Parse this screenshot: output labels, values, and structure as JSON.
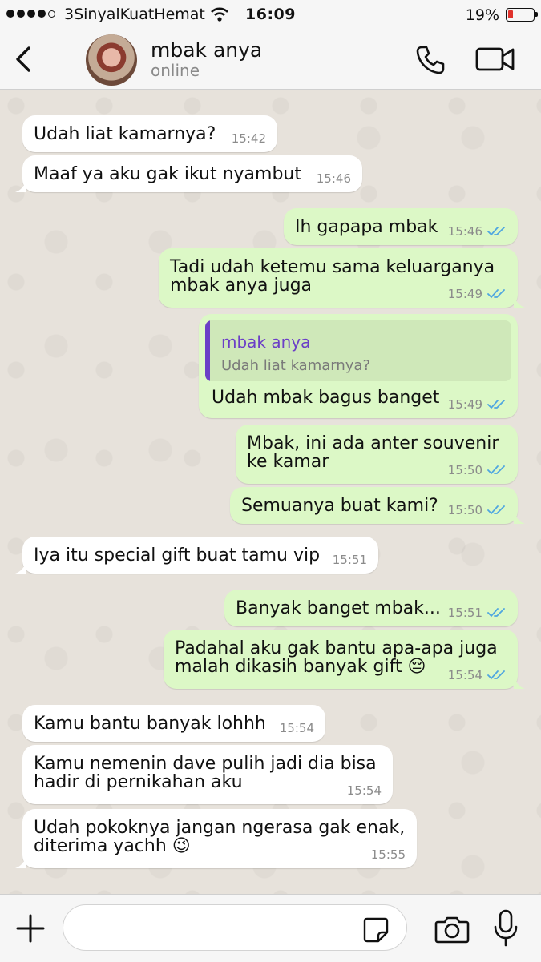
{
  "status_bar": {
    "carrier": "3SinyalKuatHemat",
    "time": "16:09",
    "battery": "19%"
  },
  "header": {
    "contact_name": "mbak anya",
    "contact_status": "online",
    "icons": [
      "back-icon",
      "avatar",
      "phone-icon",
      "video-icon"
    ]
  },
  "messages": [
    {
      "dir": "in",
      "text": "Udah liat kamarnya?",
      "time": "15:42"
    },
    {
      "dir": "in",
      "text": "Maaf ya aku gak ikut nyambut",
      "time": "15:46"
    },
    {
      "dir": "out",
      "text": "Ih gapapa mbak",
      "time": "15:46"
    },
    {
      "dir": "out",
      "line1": "Tadi udah ketemu sama keluarganya",
      "line2": "mbak anya juga",
      "time": "15:49"
    },
    {
      "dir": "out",
      "quote_name": "mbak anya",
      "quote_text": "Udah liat kamarnya?",
      "text": "Udah mbak bagus banget",
      "time": "15:49"
    },
    {
      "dir": "out",
      "line1": "Mbak, ini ada anter souvenir",
      "line2": "ke kamar",
      "time": "15:50"
    },
    {
      "dir": "out",
      "text": "Semuanya buat kami?",
      "time": "15:50"
    },
    {
      "dir": "in",
      "text": "Iya itu special gift buat tamu vip",
      "time": "15:51"
    },
    {
      "dir": "out",
      "text": "Banyak banget mbak...",
      "time": "15:51"
    },
    {
      "dir": "out",
      "line1": "Padahal aku gak bantu apa-apa juga",
      "line2": "malah dikasih banyak gift 😔",
      "time": "15:54"
    },
    {
      "dir": "in",
      "text": "Kamu bantu banyak lohhh",
      "time": "15:54"
    },
    {
      "dir": "in",
      "line1": "Kamu nemenin dave pulih jadi dia bisa",
      "line2": "hadir di pernikahan aku",
      "time": "15:54"
    },
    {
      "dir": "in",
      "line1": "Udah pokoknya jangan ngerasa gak enak,",
      "line2": "diterima yachh 😉",
      "time": "15:55"
    }
  ],
  "colors": {
    "incoming_bubble": "#ffffff",
    "outgoing_bubble": "#dcf8c6",
    "read_ticks": "#4fa6e0",
    "quote_accent": "#6b3fc7",
    "battery_low": "#e0322c"
  },
  "input_bar": {
    "icons": [
      "plus-icon",
      "sticker-icon",
      "camera-icon",
      "microphone-icon"
    ]
  }
}
